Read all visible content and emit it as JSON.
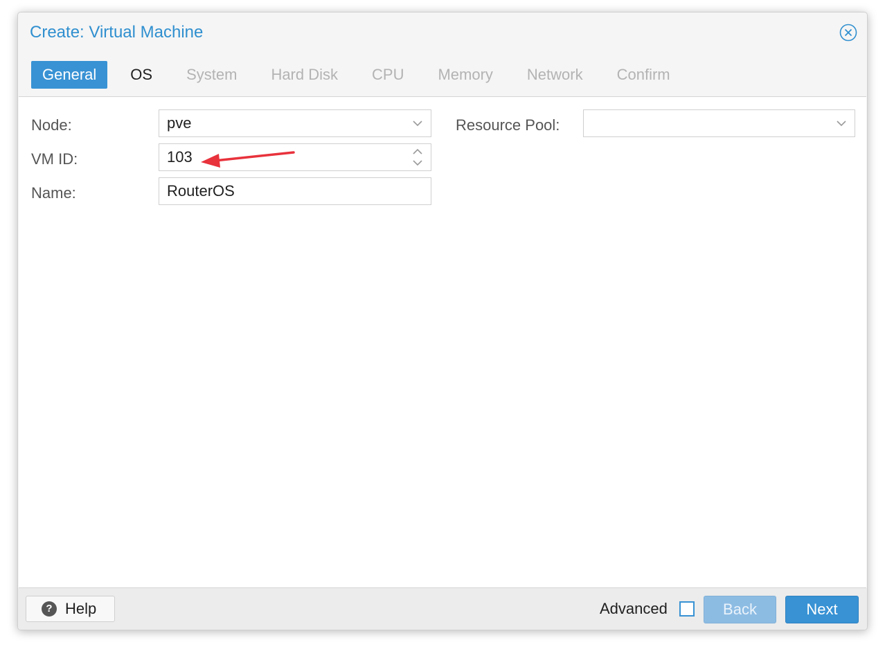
{
  "dialog": {
    "title": "Create: Virtual Machine"
  },
  "tabs": [
    {
      "label": "General",
      "state": "active"
    },
    {
      "label": "OS",
      "state": "enabled"
    },
    {
      "label": "System",
      "state": "disabled"
    },
    {
      "label": "Hard Disk",
      "state": "disabled"
    },
    {
      "label": "CPU",
      "state": "disabled"
    },
    {
      "label": "Memory",
      "state": "disabled"
    },
    {
      "label": "Network",
      "state": "disabled"
    },
    {
      "label": "Confirm",
      "state": "disabled"
    }
  ],
  "form": {
    "node_label": "Node:",
    "node_value": "pve",
    "vmid_label": "VM ID:",
    "vmid_value": "103",
    "name_label": "Name:",
    "name_value": "RouterOS",
    "pool_label": "Resource Pool:",
    "pool_value": ""
  },
  "footer": {
    "help_label": "Help",
    "advanced_label": "Advanced",
    "advanced_checked": false,
    "back_label": "Back",
    "next_label": "Next"
  },
  "colors": {
    "accent": "#3892d4",
    "title": "#2f8fcf",
    "annotation_arrow": "#e8323c"
  },
  "icons": [
    "close-circle-icon",
    "chevron-down-icon",
    "spinner-arrows-icon",
    "question-circle-icon",
    "annotation-arrow-icon"
  ]
}
